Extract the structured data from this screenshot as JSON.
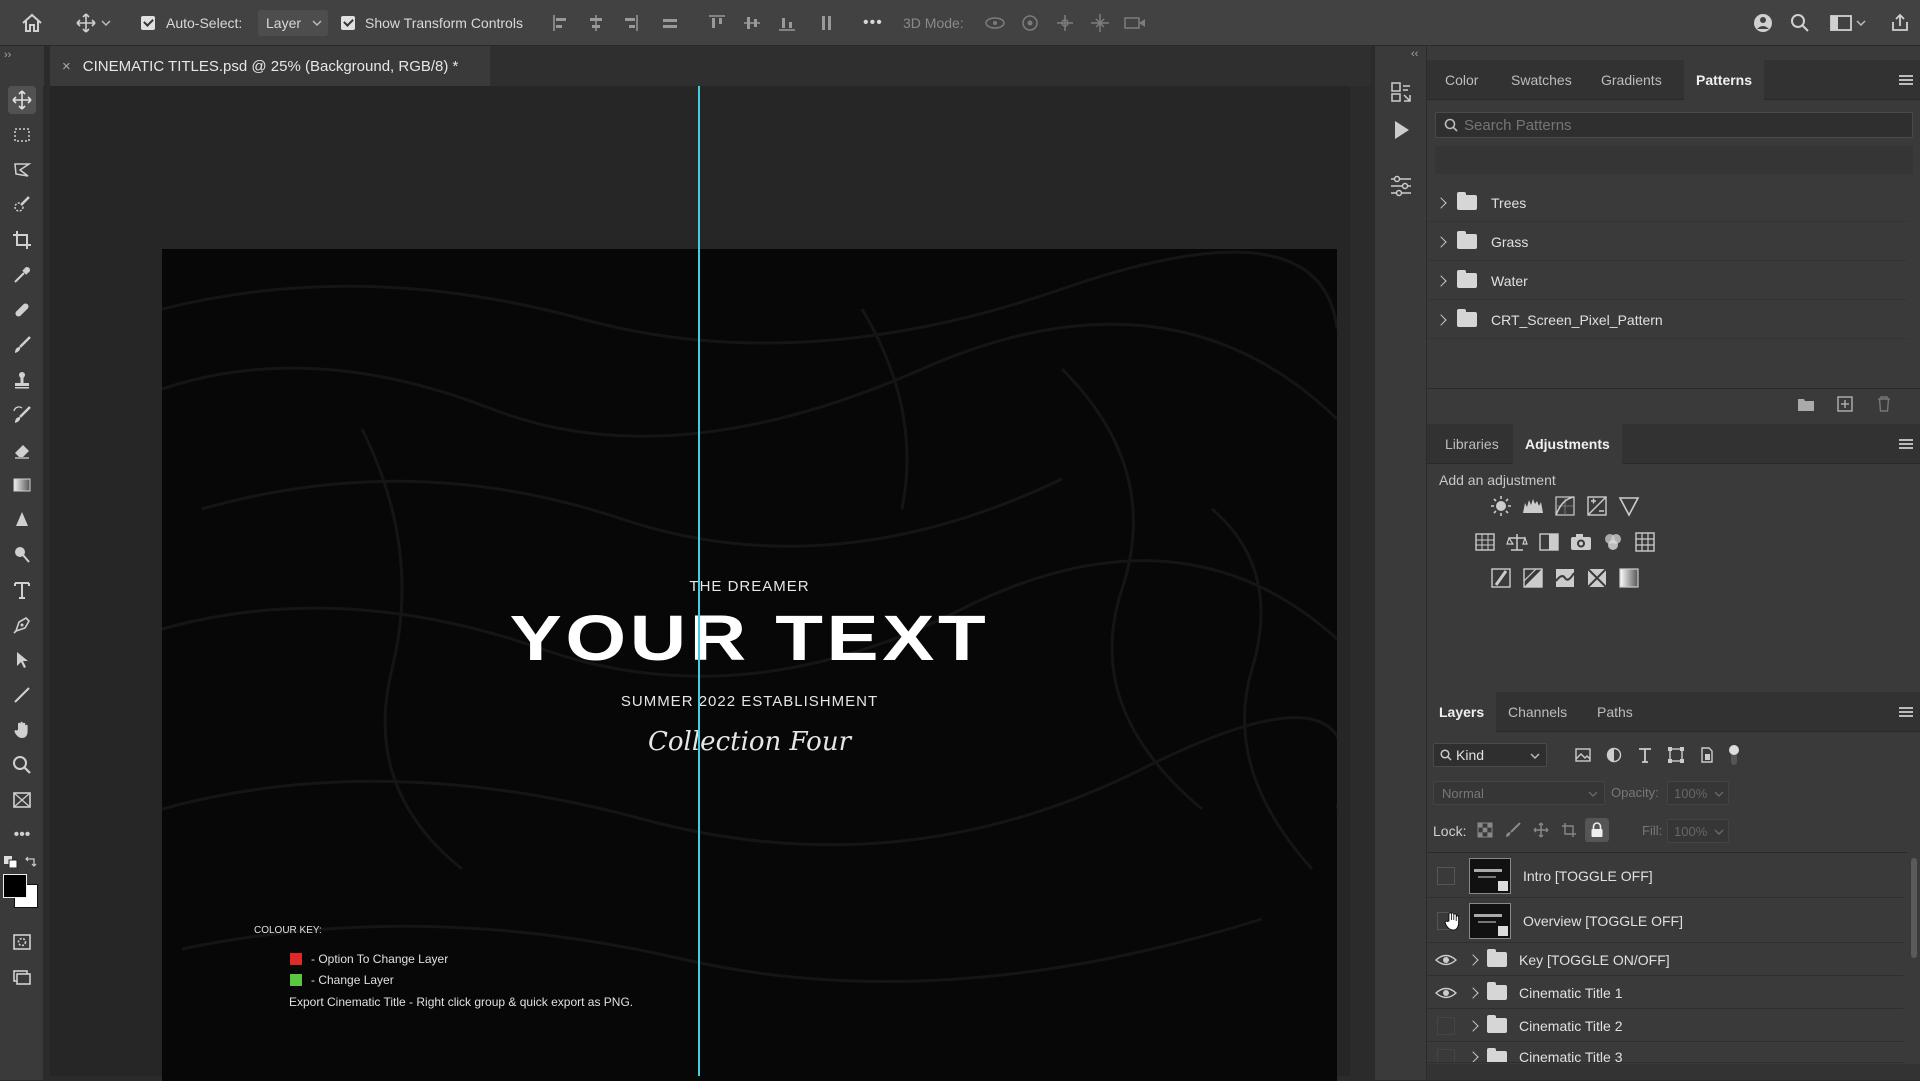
{
  "optionsbar": {
    "auto_select_label": "Auto-Select:",
    "auto_select_value": "Layer",
    "show_transform_label": "Show Transform Controls",
    "mode_3d_label": "3D Mode:",
    "more": "•••"
  },
  "document": {
    "tab_title": "CINEMATIC TITLES.psd @ 25% (Background, RGB/8) *",
    "close_glyph": "×"
  },
  "canvas": {
    "kicker": "THE DREAMER",
    "headline": "YOUR TEXT",
    "sub": "SUMMER 2022 ESTABLISHMENT",
    "script": "Collection Four",
    "key_title": "COLOUR KEY:",
    "key_items": [
      {
        "label": "- Option To Change Layer",
        "color": "#e02a2a"
      },
      {
        "label": "- Change Layer",
        "color": "#5cc640"
      }
    ],
    "key_note": "Export Cinematic Title - Right click group & quick export as PNG."
  },
  "patterns_panel": {
    "tabs": [
      "Color",
      "Swatches",
      "Gradients",
      "Patterns"
    ],
    "active_tab": "Patterns",
    "search_placeholder": "Search Patterns",
    "folders": [
      "Trees",
      "Grass",
      "Water",
      "CRT_Screen_Pixel_Pattern"
    ]
  },
  "adjustments_panel": {
    "tabs": [
      "Libraries",
      "Adjustments"
    ],
    "active_tab": "Adjustments",
    "hint": "Add an adjustment"
  },
  "layers_panel": {
    "tabs": [
      "Layers",
      "Channels",
      "Paths"
    ],
    "active_tab": "Layers",
    "filter_label": "Kind",
    "blend_mode": "Normal",
    "opacity_label": "Opacity:",
    "opacity_value": "100%",
    "lock_label": "Lock:",
    "fill_label": "Fill:",
    "fill_value": "100%",
    "layers": [
      {
        "name": "Intro [TOGGLE OFF]",
        "type": "smart",
        "visible": false
      },
      {
        "name": "Overview [TOGGLE OFF]",
        "type": "smart",
        "visible": false
      },
      {
        "name": "Key [TOGGLE ON/OFF]",
        "type": "group",
        "visible": true
      },
      {
        "name": "Cinematic Title 1",
        "type": "group",
        "visible": true
      },
      {
        "name": "Cinematic Title 2",
        "type": "group",
        "visible": false
      },
      {
        "name": "Cinematic Title 3",
        "type": "group",
        "visible": false
      }
    ]
  },
  "colors": {
    "guide": "#3fd0e0",
    "panel_bg": "#3a3a3a",
    "canvas_bg": "#070707"
  }
}
